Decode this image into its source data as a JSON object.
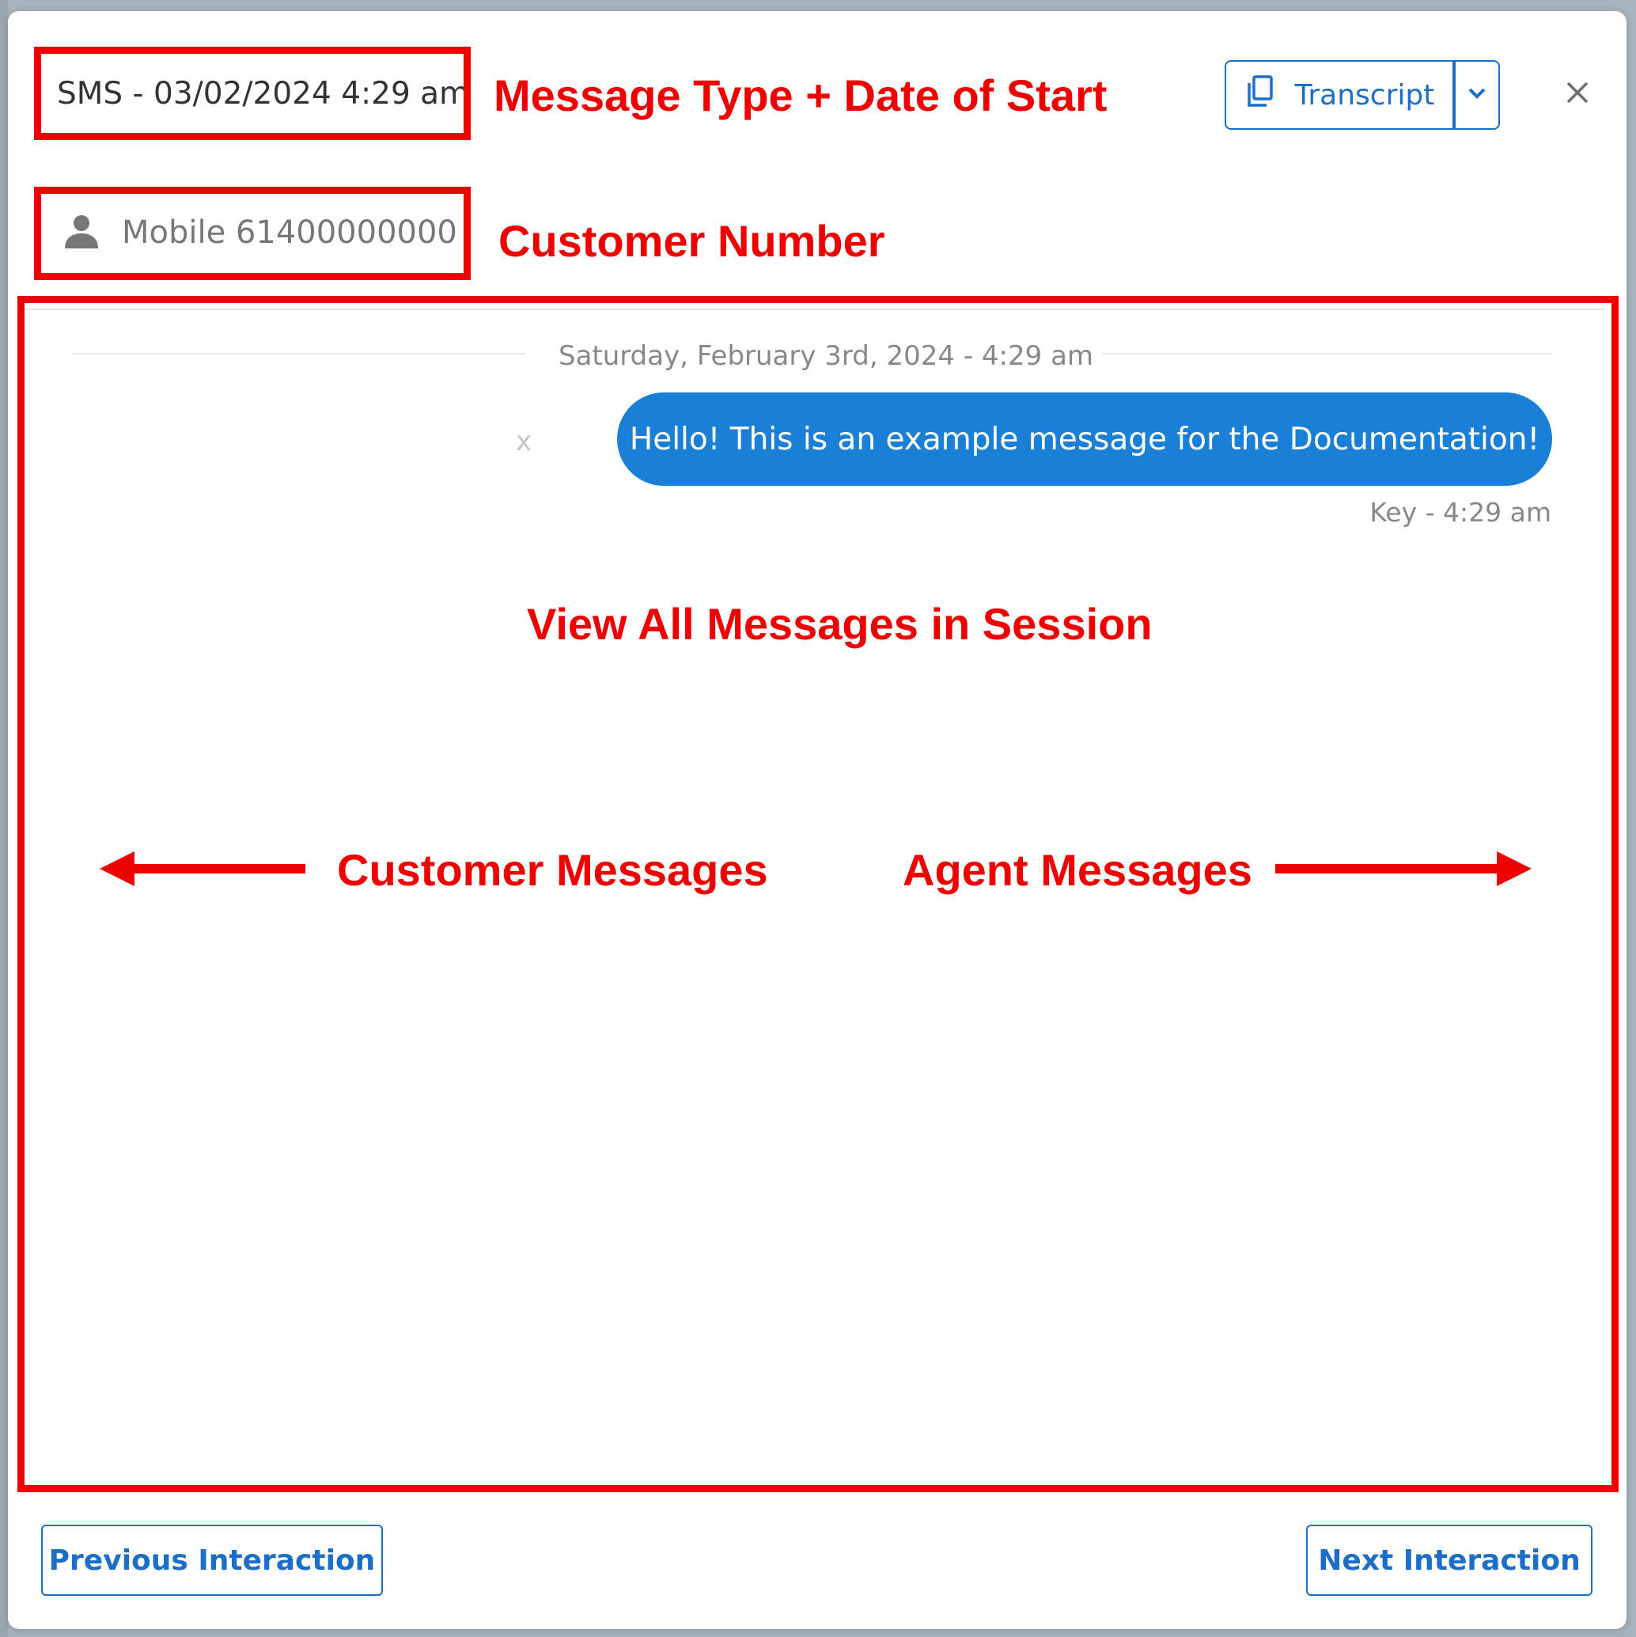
{
  "header": {
    "title": "SMS - 03/02/2024 4:29 am",
    "transcript_label": "Transcript"
  },
  "customer": {
    "number_label": "Mobile 61400000000"
  },
  "conversation": {
    "date_separator": "Saturday, February 3rd, 2024 - 4:29 am",
    "dismiss_label": "x",
    "messages": [
      {
        "side": "agent",
        "text": "Hello! This is an example message for the Documentation!",
        "meta": "Key - 4:29 am"
      }
    ]
  },
  "footer": {
    "previous_label": "Previous Interaction",
    "next_label": "Next Interaction"
  },
  "annotations": {
    "message_type": "Message Type + Date of Start",
    "customer_number": "Customer Number",
    "view_all": "View All Messages in Session",
    "customer_messages": "Customer Messages",
    "agent_messages": "Agent Messages"
  },
  "icons": {
    "customer_avatar": "person-icon",
    "transcript": "copy-icon",
    "dropdown": "chevron-down-icon",
    "close": "close-icon"
  },
  "colors": {
    "annotation_red": "#ee0000",
    "accent_blue": "#1b6fc9",
    "agent_bubble": "#1a7fd6"
  }
}
